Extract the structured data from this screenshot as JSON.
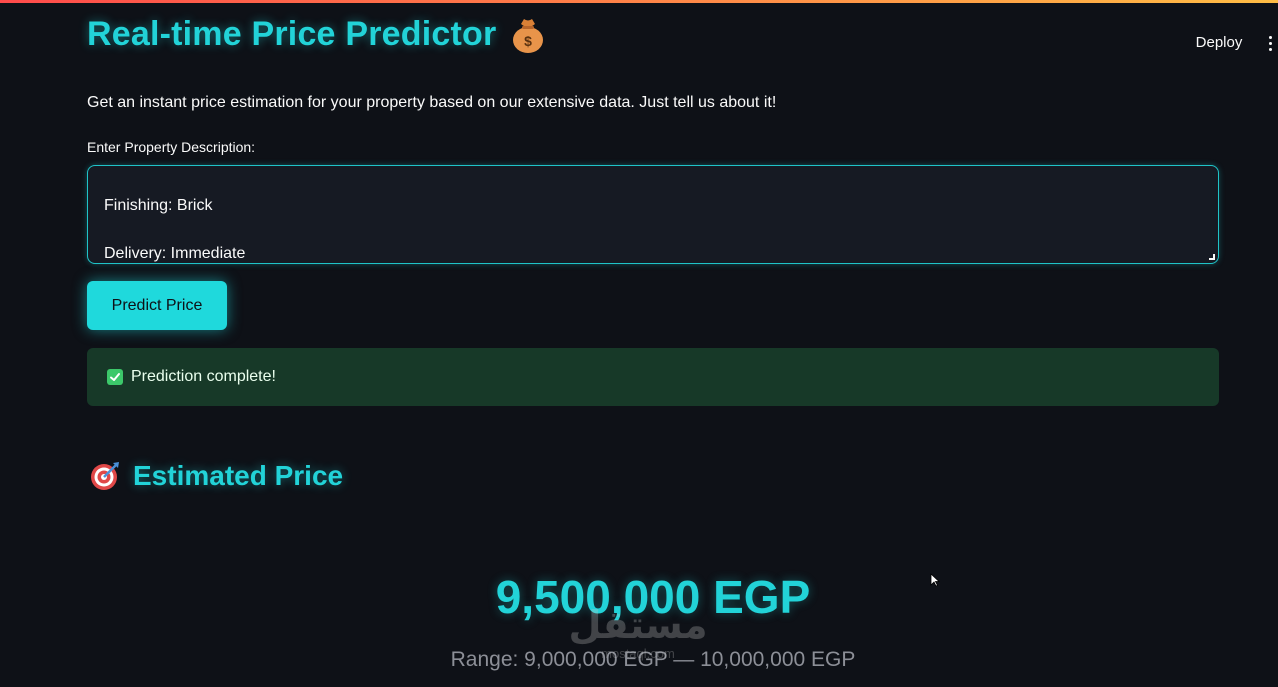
{
  "app": {
    "title": "Real-time Price Predictor",
    "title_icon": "money-bag-icon",
    "deploy_label": "Deploy",
    "menu_icon": "vertical-ellipsis-icon"
  },
  "intro": {
    "text": "Get an instant price estimation for your property based on our extensive data. Just tell us about it!"
  },
  "description_input": {
    "label": "Enter Property Description:",
    "visible_lines": [
      "Finishing: Brick",
      "Delivery: Immediate"
    ]
  },
  "predict_button": {
    "label": "Predict Price"
  },
  "status": {
    "icon": "check-mark-icon",
    "text": "Prediction complete!"
  },
  "estimate": {
    "heading": "Estimated Price",
    "heading_icon": "target-icon",
    "price": "9,500,000 EGP",
    "range": "Range: 9,000,000 EGP — 10,000,000 EGP"
  },
  "watermark": {
    "text": "مستقل",
    "subtext": "mostaql.com"
  },
  "colors": {
    "background": "#0e1117",
    "accent": "#22d3d8",
    "button": "#1fd9dc",
    "success_bg": "#173928",
    "muted_text": "#8c8f97"
  }
}
